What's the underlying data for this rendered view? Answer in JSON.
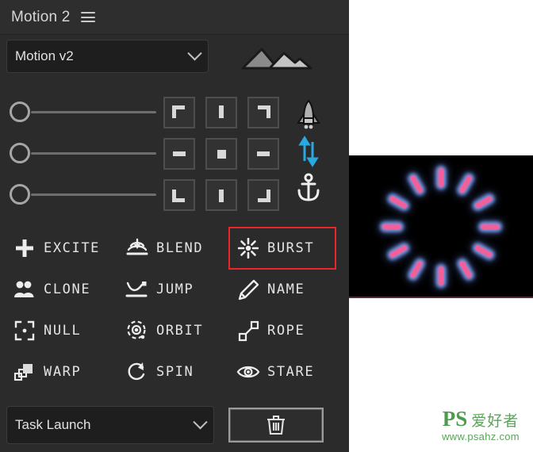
{
  "panel": {
    "title": "Motion 2",
    "menu_icon": "hamburger-icon",
    "preset": {
      "value": "Motion v2",
      "chevron": "chevron-down-icon",
      "mountain_icon": "mountain-icon"
    },
    "sliders": [
      {
        "name": "slider-1",
        "value": 0
      },
      {
        "name": "slider-2",
        "value": 0
      },
      {
        "name": "slider-3",
        "value": 0
      }
    ],
    "anchor_grid": [
      {
        "name": "anchor-top-left",
        "glyph": "corner-top-left"
      },
      {
        "name": "anchor-top-center",
        "glyph": "bar-vertical"
      },
      {
        "name": "anchor-top-right",
        "glyph": "corner-top-right"
      },
      {
        "name": "anchor-middle-left",
        "glyph": "bar-horizontal"
      },
      {
        "name": "anchor-center",
        "glyph": "square-center"
      },
      {
        "name": "anchor-middle-right",
        "glyph": "bar-horizontal"
      },
      {
        "name": "anchor-bottom-left",
        "glyph": "corner-bottom-left"
      },
      {
        "name": "anchor-bottom-center",
        "glyph": "bar-vertical"
      },
      {
        "name": "anchor-bottom-right",
        "glyph": "corner-bottom-right"
      }
    ],
    "side_icons": [
      {
        "name": "rocket-icon",
        "color": "#b8b8b8"
      },
      {
        "name": "arrows-vertical-icon",
        "color": "#29a9e1"
      },
      {
        "name": "anchor-icon",
        "color": "#e9e9e9"
      }
    ],
    "commands": [
      {
        "label": "EXCITE",
        "icon": "plus-icon",
        "selected": false
      },
      {
        "label": "BLEND",
        "icon": "blend-icon",
        "selected": false
      },
      {
        "label": "BURST",
        "icon": "burst-icon",
        "selected": true
      },
      {
        "label": "CLONE",
        "icon": "clone-icon",
        "selected": false
      },
      {
        "label": "JUMP",
        "icon": "jump-icon",
        "selected": false
      },
      {
        "label": "NAME",
        "icon": "pencil-icon",
        "selected": false
      },
      {
        "label": "NULL",
        "icon": "null-icon",
        "selected": false
      },
      {
        "label": "ORBIT",
        "icon": "orbit-icon",
        "selected": false
      },
      {
        "label": "ROPE",
        "icon": "rope-icon",
        "selected": false
      },
      {
        "label": "WARP",
        "icon": "warp-icon",
        "selected": false
      },
      {
        "label": "SPIN",
        "icon": "spin-icon",
        "selected": false
      },
      {
        "label": "STARE",
        "icon": "eye-icon",
        "selected": false
      }
    ],
    "bottom": {
      "task_value": "Task Launch",
      "task_chevron": "chevron-down-icon",
      "trash_icon": "trash-icon"
    },
    "selection_color": "#e8262b"
  },
  "preview": {
    "name": "burst-preview",
    "background": "#000000",
    "capsule_color": "#f0609a",
    "glow_color": "#8caaff",
    "capsule_count": 12,
    "capsules": [
      {
        "angle": 0,
        "radius": 62
      },
      {
        "angle": 30,
        "radius": 62
      },
      {
        "angle": 60,
        "radius": 62
      },
      {
        "angle": 90,
        "radius": 62
      },
      {
        "angle": 120,
        "radius": 62
      },
      {
        "angle": 150,
        "radius": 62
      },
      {
        "angle": 180,
        "radius": 62
      },
      {
        "angle": 210,
        "radius": 62
      },
      {
        "angle": 240,
        "radius": 62
      },
      {
        "angle": 270,
        "radius": 62
      },
      {
        "angle": 300,
        "radius": 62
      },
      {
        "angle": 330,
        "radius": 62
      }
    ]
  },
  "watermark": {
    "ps": "PS",
    "cn": "爱好者",
    "url": "www.psahz.com"
  }
}
